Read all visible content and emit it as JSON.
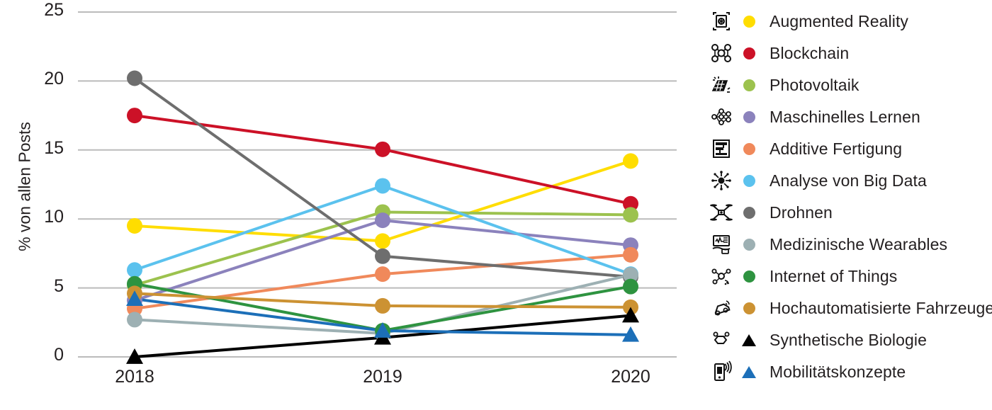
{
  "chart_data": {
    "type": "line",
    "title": "",
    "xlabel": "",
    "ylabel": "% von allen Posts",
    "x": [
      "2018",
      "2019",
      "2020"
    ],
    "categories": [
      "2018",
      "2019",
      "2020"
    ],
    "ylim": [
      0,
      25
    ],
    "yticks": [
      0,
      5,
      10,
      15,
      20,
      25
    ],
    "grid": "horizontal",
    "legend_position": "right",
    "series": [
      {
        "name": "Augmented Reality",
        "values": [
          9.5,
          8.4,
          14.2
        ],
        "color": "#FFDD00",
        "marker": "circle",
        "icon": "ar-cube-icon"
      },
      {
        "name": "Blockchain",
        "values": [
          17.5,
          15.05,
          11.1
        ],
        "color": "#CC1127",
        "marker": "circle",
        "icon": "blockchain-nodes-icon"
      },
      {
        "name": "Photovoltaik",
        "values": [
          5.2,
          10.5,
          10.3
        ],
        "color": "#9CC24E",
        "marker": "circle",
        "icon": "solar-panel-icon"
      },
      {
        "name": "Maschinelles Lernen",
        "values": [
          4.1,
          9.9,
          8.1
        ],
        "color": "#8B82BC",
        "marker": "circle",
        "icon": "neural-network-icon"
      },
      {
        "name": "Additive Fertigung",
        "values": [
          3.5,
          6.0,
          7.4
        ],
        "color": "#F0895B",
        "marker": "circle",
        "icon": "3d-printer-icon"
      },
      {
        "name": "Analyse von Big Data",
        "values": [
          6.3,
          12.4,
          6.0
        ],
        "color": "#5BC2EE",
        "marker": "circle",
        "icon": "big-data-icon"
      },
      {
        "name": "Drohnen",
        "values": [
          20.2,
          7.3,
          5.8
        ],
        "color": "#6E6E6E",
        "marker": "circle",
        "icon": "drone-icon"
      },
      {
        "name": "Medizinische Wearables",
        "values": [
          2.7,
          1.7,
          5.95
        ],
        "color": "#9DB0B3",
        "marker": "circle",
        "icon": "medical-wearable-icon"
      },
      {
        "name": "Internet of Things",
        "values": [
          5.3,
          1.9,
          5.1
        ],
        "color": "#2E9340",
        "marker": "circle",
        "icon": "iot-network-icon"
      },
      {
        "name": "Hochautomatisierte Fahrzeuge",
        "values": [
          4.6,
          3.7,
          3.6
        ],
        "color": "#CC9233",
        "marker": "circle",
        "icon": "autonomous-vehicle-icon"
      },
      {
        "name": "Synthetische Biologie",
        "values": [
          0.0,
          1.4,
          3.0
        ],
        "color": "#000000",
        "marker": "triangle",
        "icon": "molecule-icon"
      },
      {
        "name": "Mobilitätskonzepte",
        "values": [
          4.2,
          1.9,
          1.6
        ],
        "color": "#1C6FB8",
        "marker": "triangle",
        "icon": "mobile-signal-icon"
      }
    ]
  },
  "axis": {
    "y_title": "% von allen Posts",
    "y_ticks": [
      "0",
      "5",
      "10",
      "15",
      "20",
      "25"
    ],
    "x_ticks": [
      "2018",
      "2019",
      "2020"
    ]
  },
  "legend": {
    "items": [
      {
        "label": "Augmented Reality"
      },
      {
        "label": "Blockchain"
      },
      {
        "label": "Photovoltaik"
      },
      {
        "label": "Maschinelles Lernen"
      },
      {
        "label": "Additive Fertigung"
      },
      {
        "label": "Analyse von Big Data"
      },
      {
        "label": "Drohnen"
      },
      {
        "label": "Medizinische Wearables"
      },
      {
        "label": "Internet of Things"
      },
      {
        "label": "Hochautomatisierte Fahrzeuge"
      },
      {
        "label": "Synthetische Biologie"
      },
      {
        "label": "Mobilitätskonzepte"
      }
    ]
  },
  "colors": {
    "grid": "#BBBBBB",
    "text": "#231f20",
    "background": "#FFFFFF"
  }
}
